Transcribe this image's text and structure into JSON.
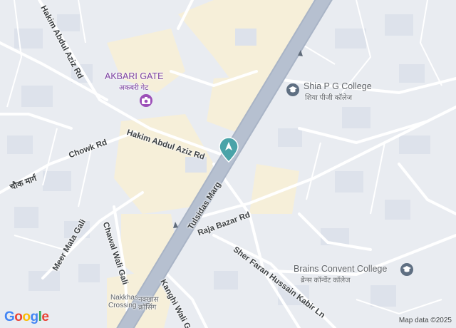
{
  "map": {
    "colors": {
      "background": "#e9ecf1",
      "road": "#ffffff",
      "main_road": "#a9b4c6",
      "block": "#f6efd9",
      "accent": "#7b3fa0"
    },
    "poi": [
      {
        "name": "AKBARI GATE",
        "sub": "अकबरी गेट",
        "icon": "camera-icon"
      },
      {
        "name": "Shia P G College",
        "sub": "शिया पीजी कॉलेज",
        "icon": "school-icon"
      },
      {
        "name": "Brains Convent College",
        "sub": "ब्रेन्स कॉन्वेंट कॉलेज",
        "icon": "school-icon"
      }
    ],
    "roads": {
      "hakim_abdul_aziz_top": "Hakim Abdul Aziz Rd",
      "hakim_abdul_aziz_mid": "Hakim Abdul Aziz Rd",
      "chowk_rd": "Chowk Rd",
      "chowk_marg": "चौक मार्ग",
      "tulsidas_marg": "Tulsidas Marg",
      "raja_bazar_rd": "Raja Bazar Rd",
      "sher_faran": "Sher Faran Hussain Kabir Ln",
      "meer_mata": "Meer Mata Gali",
      "chawal_wali": "Chawal Wali Gali",
      "kanghi_wali": "Kanghi Wali Gali",
      "nakkhas_en": "Nakkhas",
      "nakkhas_en2": "Crossing",
      "nakkhas_hi": "नक्खास",
      "nakkhas_hi2": "क्रॉसिंग"
    },
    "branding": "Google",
    "attribution": "Map data ©2025"
  }
}
